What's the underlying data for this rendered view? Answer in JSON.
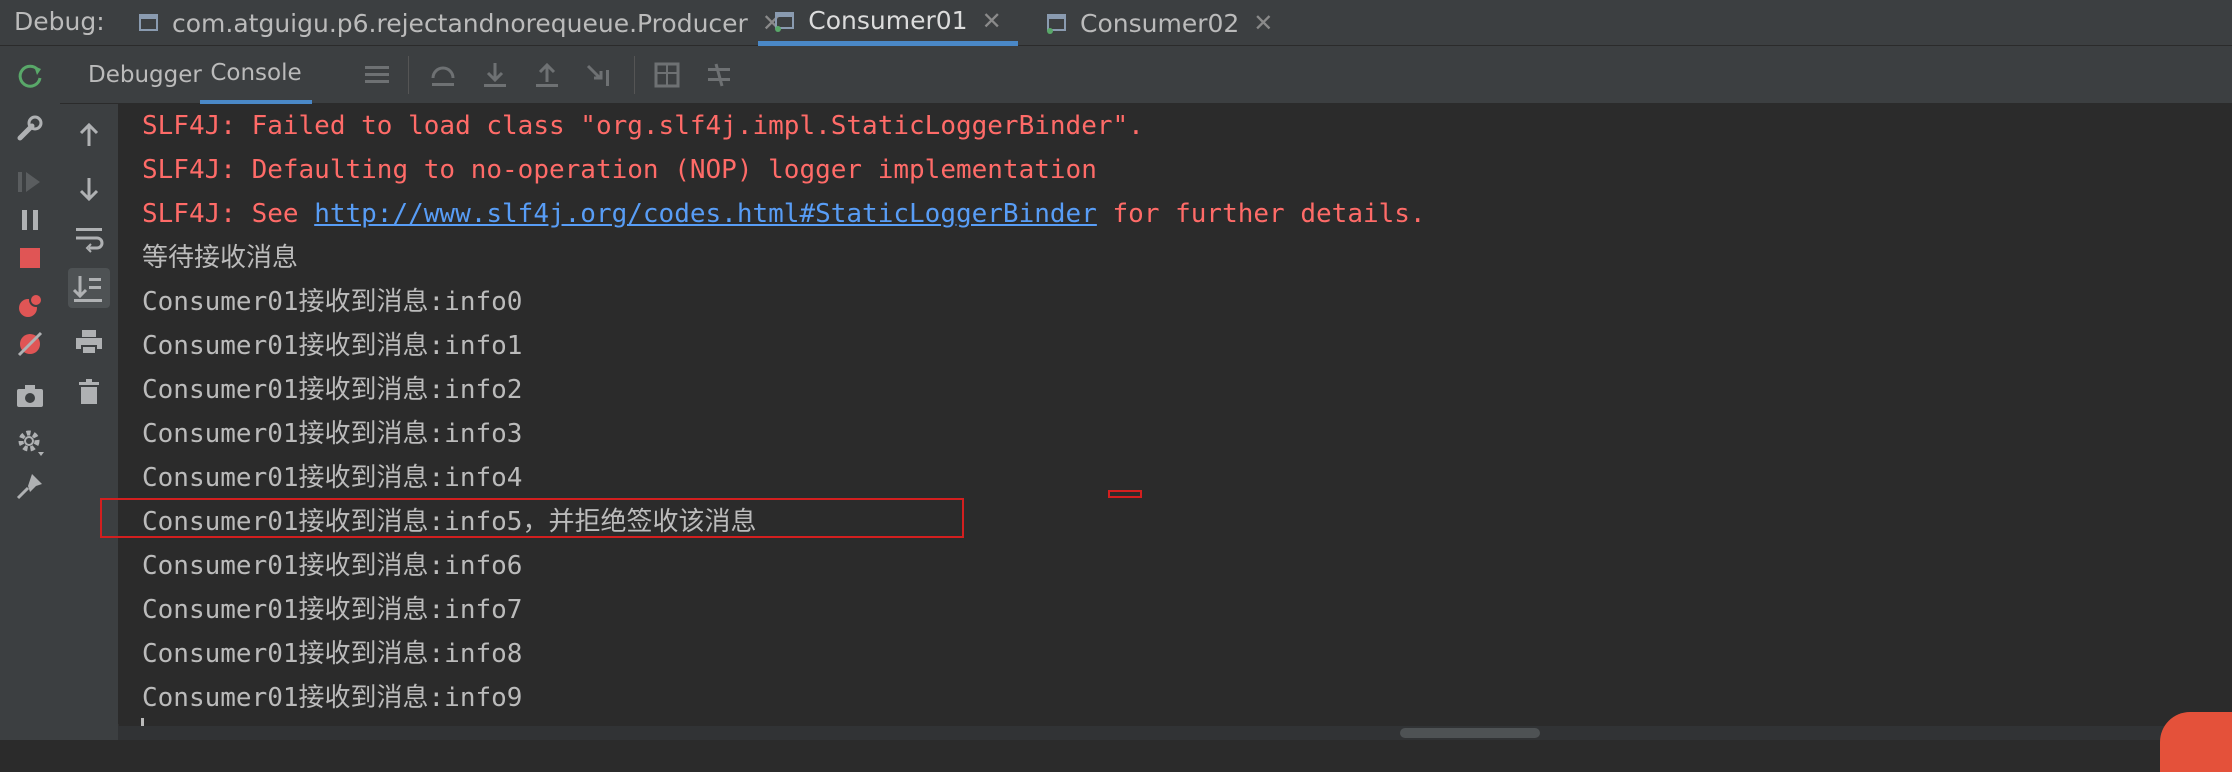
{
  "tabbar": {
    "debug_label": "Debug:",
    "tabs": [
      {
        "label": "com.atguigu.p6.rejectandnorequeue.Producer",
        "active": false
      },
      {
        "label": "Consumer01",
        "active": true
      },
      {
        "label": "Consumer02",
        "active": false
      }
    ]
  },
  "subtabs": {
    "debugger": "Debugger",
    "console": "Console"
  },
  "outer_toolbar": [
    "rerun-icon",
    "settings-wrench-icon",
    "resume-icon",
    "pause-icon",
    "stop-icon",
    "view-breakpoints-icon",
    "mute-breakpoints-icon",
    "camera-icon",
    "gear-icon",
    "pin-icon"
  ],
  "inner_toolbar": [
    "up-arrow-icon",
    "down-arrow-icon",
    "soft-wrap-icon",
    "scroll-to-end-icon",
    "print-icon",
    "trash-icon"
  ],
  "console": {
    "lines": [
      {
        "text": "SLF4J: Failed to load class \"org.slf4j.impl.StaticLoggerBinder\".",
        "type": "error"
      },
      {
        "text": "SLF4J: Defaulting to no-operation (NOP) logger implementation",
        "type": "error"
      },
      {
        "prefix": "SLF4J: See ",
        "link": "http://www.slf4j.org/codes.html#StaticLoggerBinder",
        "suffix": " for further details.",
        "type": "error"
      },
      {
        "text": "等待接收消息",
        "type": "normal"
      },
      {
        "text": "Consumer01接收到消息:info0",
        "type": "normal"
      },
      {
        "text": "Consumer01接收到消息:info1",
        "type": "normal"
      },
      {
        "text": "Consumer01接收到消息:info2",
        "type": "normal"
      },
      {
        "text": "Consumer01接收到消息:info3",
        "type": "normal"
      },
      {
        "text": "Consumer01接收到消息:info4",
        "type": "normal"
      },
      {
        "text": "Consumer01接收到消息:info5，并拒绝签收该消息",
        "type": "normal"
      },
      {
        "text": "Consumer01接收到消息:info6",
        "type": "normal"
      },
      {
        "text": "Consumer01接收到消息:info7",
        "type": "normal"
      },
      {
        "text": "Consumer01接收到消息:info8",
        "type": "normal"
      },
      {
        "text": "Consumer01接收到消息:info9",
        "type": "normal"
      }
    ]
  },
  "colors": {
    "error": "#ff6b68",
    "link": "#589df6",
    "accent": "#4a88c7",
    "highlight": "#d31f1f"
  }
}
